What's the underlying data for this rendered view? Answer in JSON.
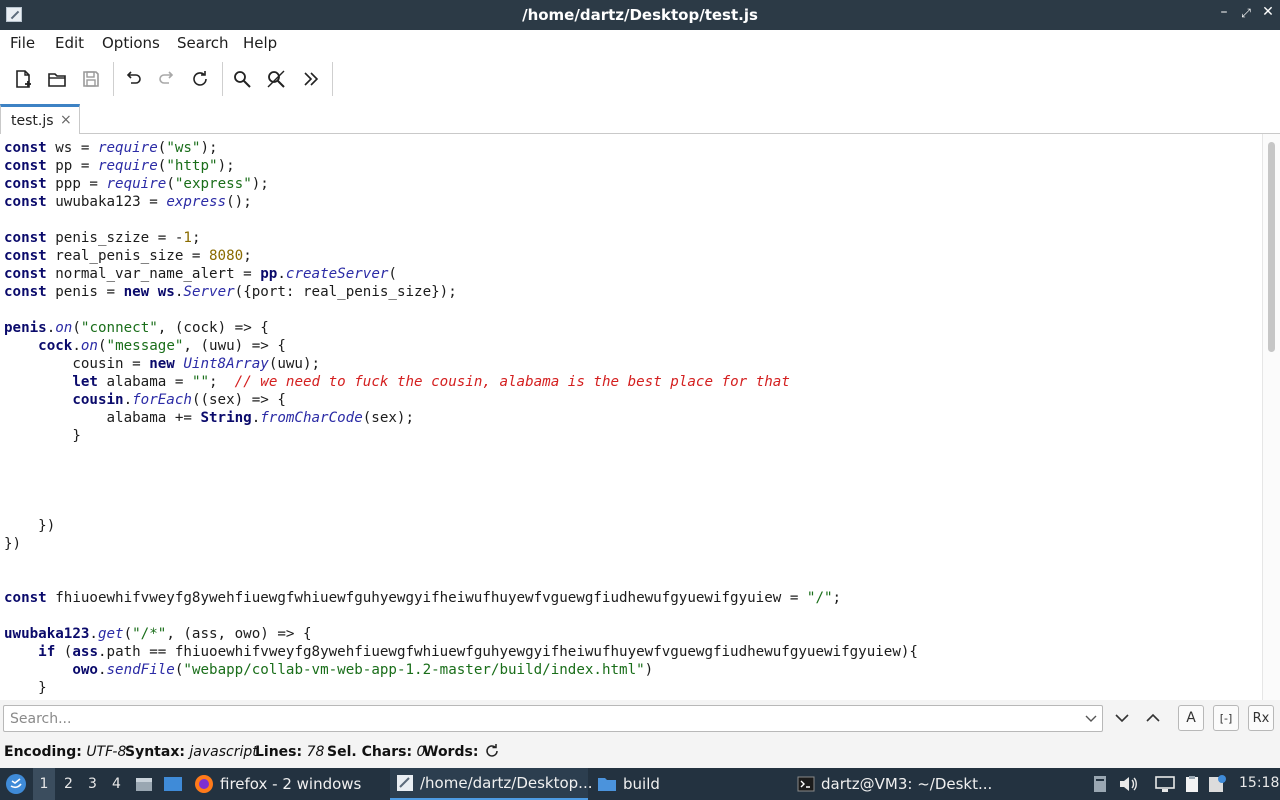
{
  "window": {
    "title": "/home/dartz/Desktop/test.js"
  },
  "menu": {
    "items": [
      "File",
      "Edit",
      "Options",
      "Search",
      "Help"
    ]
  },
  "toolbar": {
    "buttons": [
      "new-document",
      "open-folder",
      "save",
      "undo",
      "redo",
      "reload",
      "find",
      "find-replace",
      "more"
    ]
  },
  "tabs": [
    {
      "label": "test.js",
      "close": "×"
    }
  ],
  "editor": {
    "language": "javascript",
    "lines": [
      "const ws = require(\"ws\");",
      "const pp = require(\"http\");",
      "const ppp = require(\"express\");",
      "const uwubaka123 = express();",
      "",
      "const penis_szize = -1;",
      "const real_penis_size = 8080;",
      "const normal_var_name_alert = pp.createServer(",
      "const penis = new ws.Server({port: real_penis_size});",
      "",
      "penis.on(\"connect\", (cock) => {",
      "    cock.on(\"message\", (uwu) => {",
      "        cousin = new Uint8Array(uwu);",
      "        let alabama = \"\";  // we need to fuck the cousin, alabama is the best place for that",
      "        cousin.forEach((sex) => {",
      "            alabama += String.fromCharCode(sex);",
      "        }",
      "",
      "",
      "",
      "",
      "    })",
      "})",
      "",
      "",
      "const fhiuoewhifvweyfg8ywehfiuewgfwhiuewfguhyewgyifheiwufhuyewfvguewgfiudhewufgyuewifgyuiew = \"/\";",
      "",
      "uwubaka123.get(\"/*\", (ass, owo) => {",
      "    if (ass.path == fhiuoewhifvweyfg8ywehfiuewgfwhiuewfguhyewgyifheiwufhuyewfvguewgfiudhewufgyuewifgyuiew){",
      "        owo.sendFile(\"webapp/collab-vm-web-app-1.2-master/build/index.html\")",
      "    }"
    ]
  },
  "search": {
    "placeholder": "Search...",
    "match_case": "A",
    "whole_word": "[-]",
    "regex": "Rx"
  },
  "status": {
    "encoding_label": "Encoding:",
    "encoding_value": "UTF-8",
    "syntax_label": "Syntax:",
    "syntax_value": "javascript",
    "lines_label": "Lines:",
    "lines_value": "78",
    "selchars_label": "Sel. Chars:",
    "selchars_value": "0",
    "words_label": "Words:"
  },
  "taskbar": {
    "workspaces": [
      "1",
      "2",
      "3",
      "4"
    ],
    "tasks": [
      {
        "label": "firefox - 2 windows",
        "icon": "firefox-icon"
      },
      {
        "label": "/home/dartz/Desktop...",
        "icon": "text-editor-icon",
        "active": true
      },
      {
        "label": "build",
        "icon": "folder-icon"
      },
      {
        "label": "dartz@VM3: ~/Deskt...",
        "icon": "terminal-icon"
      }
    ],
    "clock": "15:18"
  },
  "colors": {
    "titlebar": "#2c3a46",
    "taskbar": "#233240",
    "accent": "#3d82c4"
  }
}
